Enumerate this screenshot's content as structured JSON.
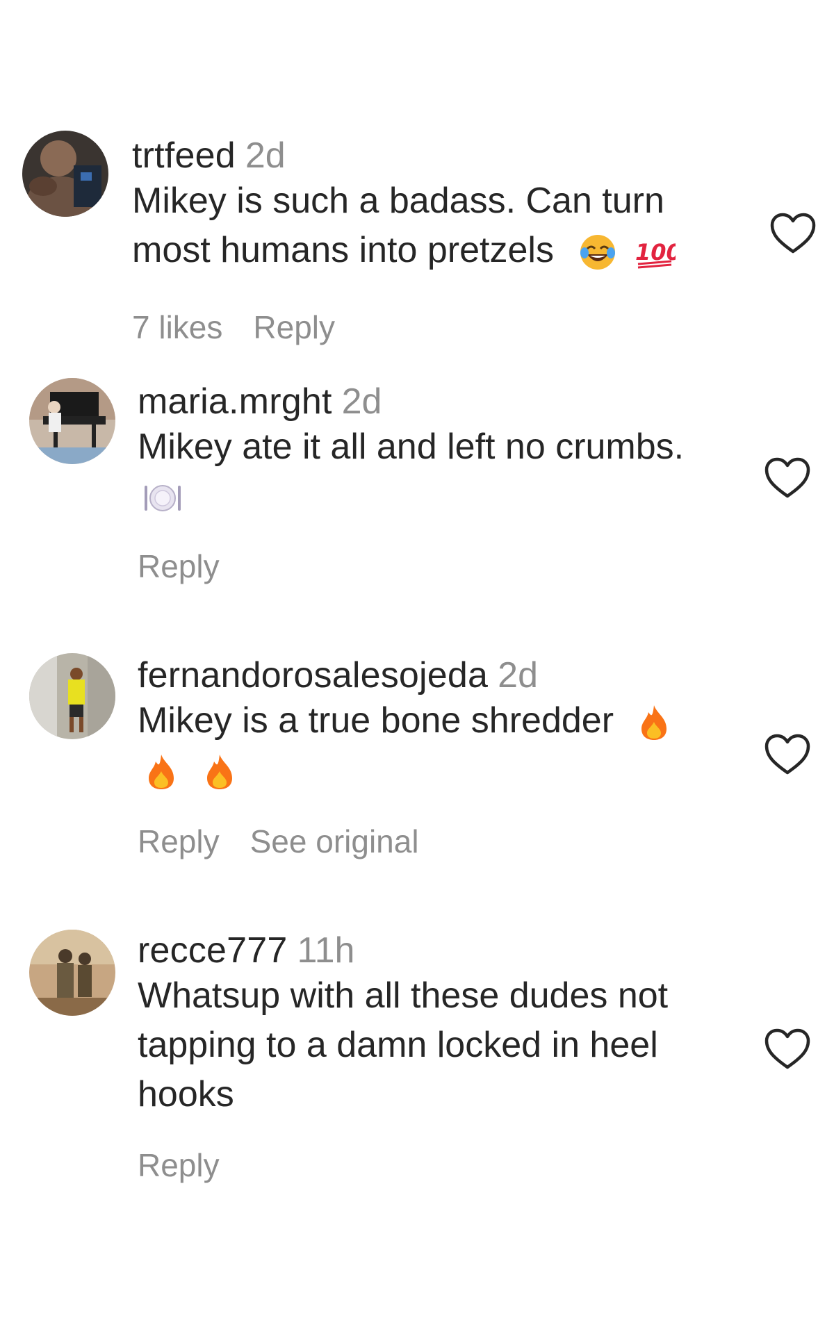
{
  "comments": [
    {
      "username": "trtfeed",
      "time": "2d",
      "text_lines": [
        "Mikey is such a badass. Can turn",
        "most humans into pretzels"
      ],
      "emojis": [
        "laughing-crying-emoji",
        "hundred-points-emoji"
      ],
      "likes": "7 likes",
      "reply": "Reply"
    },
    {
      "username": "maria.mrght",
      "time": "2d",
      "text_lines": [
        "Mikey ate it all and left no crumbs."
      ],
      "emojis": [
        "fork-knife-plate-emoji"
      ],
      "reply": "Reply"
    },
    {
      "username": "fernandorosalesojeda",
      "time": "2d",
      "text_lines": [
        "Mikey is a true bone shredder"
      ],
      "emojis": [
        "fire-emoji",
        "fire-emoji",
        "fire-emoji"
      ],
      "reply": "Reply",
      "see_original": "See original"
    },
    {
      "username": "recce777",
      "time": "11h",
      "text_lines": [
        "Whatsup with all these dudes not",
        "tapping to a damn locked in heel",
        "hooks"
      ],
      "emojis": [],
      "reply": "Reply"
    }
  ],
  "icons": {
    "like": "heart-outline-icon"
  },
  "colors": {
    "text": "#262626",
    "secondary": "#8e8e8e",
    "background": "#ffffff"
  }
}
